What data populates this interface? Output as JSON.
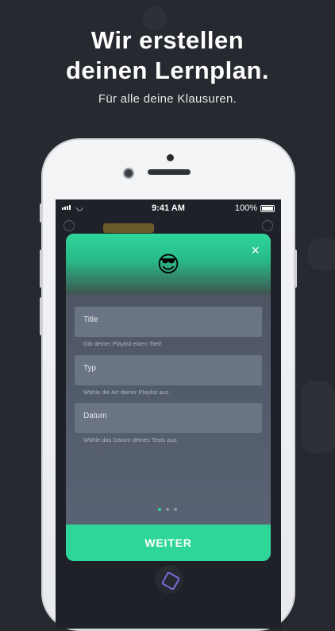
{
  "headline": {
    "line1": "Wir erstellen",
    "line2": "deinen Lernplan."
  },
  "subline": "Für alle deine Klausuren.",
  "status_bar": {
    "time": "9:41 AM",
    "battery": "100%"
  },
  "modal": {
    "emoji": "😎",
    "close_label": "×",
    "fields": [
      {
        "label": "Title",
        "hint": "Gib deiner Playlist einen Titel!"
      },
      {
        "label": "Typ",
        "hint": "Wähle die Art deiner Playlist aus"
      },
      {
        "label": "Datum",
        "hint": "Wähle das Datum deines Tests aus."
      }
    ],
    "pagination": {
      "count": 3,
      "active": 1
    },
    "cta_label": "WEITER"
  },
  "colors": {
    "accent": "#2ed69a",
    "background": "#26292f"
  },
  "icons": [
    "signal-icon",
    "wifi-icon",
    "battery-icon",
    "close-icon",
    "hexagon-logo-icon"
  ]
}
